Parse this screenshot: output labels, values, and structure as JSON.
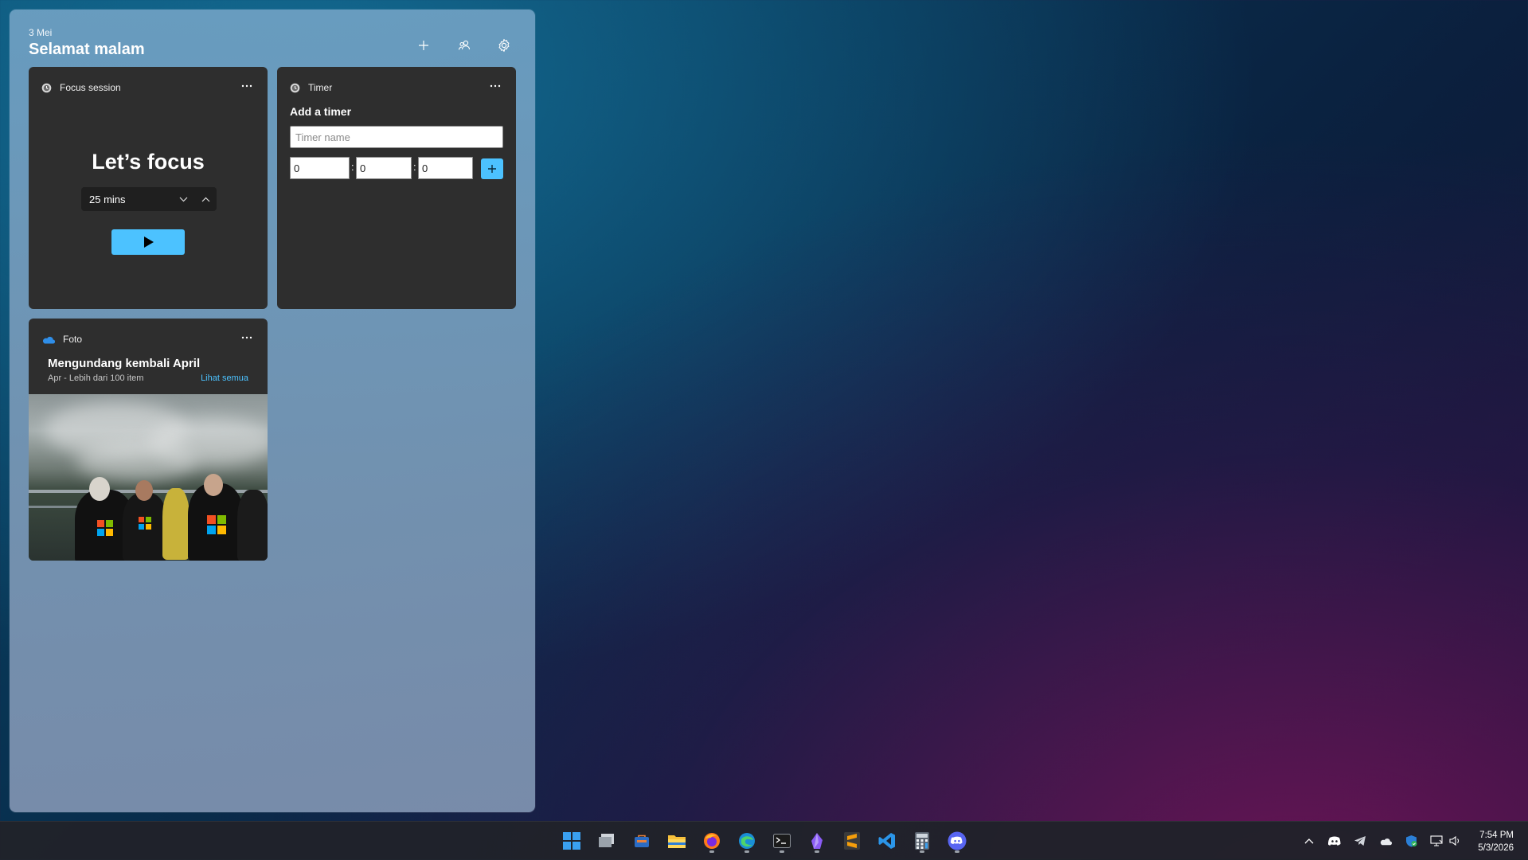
{
  "panel": {
    "date": "3 Mei",
    "greeting": "Selamat malam"
  },
  "focus": {
    "title": "Focus session",
    "heading": "Let’s focus",
    "duration": "25 mins"
  },
  "timer": {
    "title": "Timer",
    "subtitle": "Add a timer",
    "name_placeholder": "Timer name",
    "hours": "0",
    "minutes": "0",
    "seconds": "0",
    "separator": ":"
  },
  "photos": {
    "title": "Foto",
    "album_title": "Mengundang kembali April",
    "album_meta": "Apr - Lebih dari 100 item",
    "see_all": "Lihat semua"
  },
  "clock": {
    "time": "7:54 PM",
    "date": "5/3/2026"
  },
  "taskbar_apps": [
    "start",
    "task-view",
    "store",
    "file-explorer",
    "firefox",
    "edge",
    "terminal",
    "obsidian",
    "sublime-text",
    "vscode",
    "calculator",
    "discord"
  ],
  "colors": {
    "accent": "#4cc2ff",
    "card": "#2e2e2e"
  }
}
